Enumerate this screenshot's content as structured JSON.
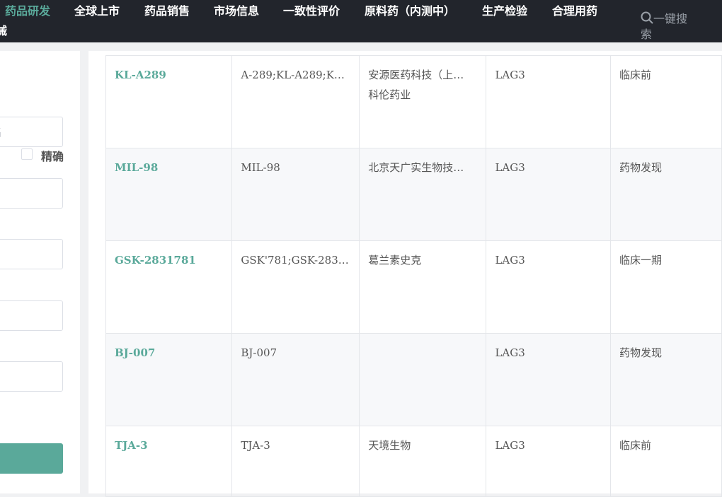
{
  "nav": {
    "items": [
      "药品研发",
      "全球上市",
      "药品销售",
      "市场信息",
      "一致性评价",
      "原料药（内测中）",
      "生产检验",
      "合理用药"
    ],
    "overflow": "械",
    "search": "一键搜索"
  },
  "filter": {
    "exact_label": "精确",
    "name_placeholder": "名"
  },
  "table": {
    "rows": [
      {
        "code": "KL-A289",
        "alias": "A-289;KL-A289;K…",
        "company": [
          "安源医药科技（上…",
          "科伦药业"
        ],
        "target": "LAG3",
        "stage": "临床前"
      },
      {
        "code": "MIL-98",
        "alias": "MIL-98",
        "company": [
          "北京天广实生物技…"
        ],
        "target": "LAG3",
        "stage": "药物发现"
      },
      {
        "code": "GSK-2831781",
        "alias": "GSK'781;GSK-283…",
        "company": [
          "葛兰素史克"
        ],
        "target": "LAG3",
        "stage": "临床一期"
      },
      {
        "code": "BJ-007",
        "alias": "BJ-007",
        "company": [],
        "target": "LAG3",
        "stage": "药物发现"
      },
      {
        "code": "TJA-3",
        "alias": "TJA-3",
        "company": [
          "天境生物"
        ],
        "target": "LAG3",
        "stage": "临床前"
      }
    ]
  }
}
